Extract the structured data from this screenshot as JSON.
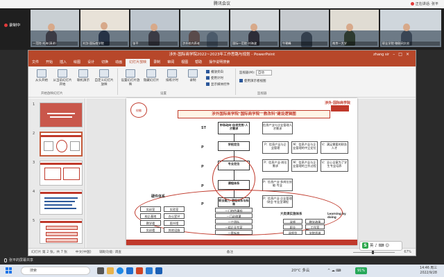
{
  "meeting": {
    "title": "腾讯会议",
    "speaking_label": "正在讲话: 张平",
    "recording_label": "录制中",
    "participants": [
      {
        "name": "一范院-刘海(演讲)"
      },
      {
        "name": "刘剑-国际商学院"
      },
      {
        "name": "张平"
      },
      {
        "name": "涉外校内养老"
      },
      {
        "name": "国际一范院-刘海波"
      },
      {
        "name": "牛朝峰"
      },
      {
        "name": "南京—大学"
      },
      {
        "name": "职业学院·物联网文创"
      }
    ],
    "bottom_speaker": "张平的屏幕共享"
  },
  "ppt": {
    "window_title": "涉外·国际商学院2022~2023年工作思路与规划 - PowerPoint",
    "user": "zhang sir",
    "tabs": [
      "文件",
      "开始",
      "插入",
      "绘图",
      "设计",
      "切换",
      "动画",
      "幻灯片放映",
      "录制",
      "审阅",
      "视图",
      "帮助",
      "操作说明搜索"
    ],
    "active_tab_index": 7,
    "ribbon": {
      "groups": [
        "开始放映幻灯片",
        "设置",
        "监视器"
      ],
      "buttons": [
        {
          "label": "从头开始"
        },
        {
          "label": "从当前幻灯片开始"
        },
        {
          "label": "联机演示"
        },
        {
          "label": "自定义幻灯片放映"
        },
        {
          "label": "设置幻灯片放映"
        },
        {
          "label": "隐藏幻灯片"
        },
        {
          "label": "排练计时"
        },
        {
          "label": "录制"
        }
      ],
      "checks": [
        {
          "label": "播放旁白",
          "checked": true
        },
        {
          "label": "使用计时",
          "checked": true
        },
        {
          "label": "显示媒体控件",
          "checked": true
        },
        {
          "label": "使用演示者视图",
          "checked": true
        }
      ],
      "monitor_label": "监视器(M):",
      "monitor_value": "自动"
    },
    "thumbnails": [
      {
        "num": "1"
      },
      {
        "num": "2",
        "selected": true
      },
      {
        "num": "3"
      },
      {
        "num": "4"
      },
      {
        "num": "5"
      }
    ],
    "status": {
      "slide_info": "幻灯片 第 2 张，共 7 张",
      "language": "中文(中国)",
      "accessibility": "辅助功能: 调查",
      "notes": "备注",
      "zoom": "67%"
    }
  },
  "slide": {
    "school": "涉外·国际商学院",
    "header": "涉外国际商学院\"国际商学院\"\"教改科\"建设逻辑图",
    "row_labels": [
      "ST",
      "P",
      "P",
      "P",
      "P"
    ],
    "center_boxes": [
      "市场动向·自发优势·人才需求",
      "学校定位",
      "专业定位",
      "课程体系",
      "职业能力·课程体系与标准"
    ],
    "right_boxes": [
      [
        "信息产业与企业管理人才需求"
      ],
      [
        "P：信息产业与企业管理",
        "M：信息产业与企业管理的中立定位",
        "V：满足需要的财务人才"
      ],
      [
        "P：信息产业·岗位需求",
        "M：信息产业与企业管理的工作过程",
        "V：中国西部以信息产业培养专业型人才",
        "V：全心全意为了学生专业培养"
      ],
      [
        "P：信息产业·多岗位技能·专业"
      ],
      [
        "P：信息产业·企业管理·财会·专业型课程"
      ]
    ],
    "left_label": "硬件体系",
    "right_label": "大类课实施体系",
    "learning_label": "Learning by doing",
    "left_items": [
      "实训室",
      "实验室",
      "校企基地",
      "办公室VI",
      "教学楼",
      "图书馆",
      "实训楼",
      "其他设施"
    ],
    "mid_items": [
      "一门特色课程",
      "一门必修课",
      "一个团队",
      "一组企业专家",
      "一套标准",
      "一个课程"
    ],
    "right_items": [
      "双师",
      "教学改革",
      "职业",
      "工作室",
      "双师型",
      "学院资源"
    ]
  },
  "taskbar": {
    "search_placeholder": "搜索",
    "weather": "20°C 多云",
    "ime": "英",
    "battery": "91%",
    "time": "14:46",
    "date": "2022/9/28",
    "weekday": "周三"
  },
  "colors": {
    "ppt_brand": "#b7472a",
    "slide_red": "#c0392b",
    "meeting_dark": "#1f1f1f"
  }
}
